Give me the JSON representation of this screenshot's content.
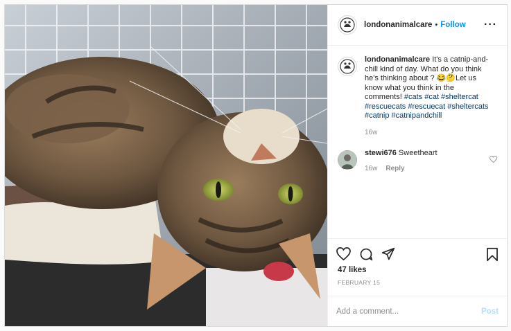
{
  "post": {
    "username": "londonanimalcare",
    "separator": "•",
    "follow_label": "Follow",
    "more_icon": "more-options-icon",
    "caption_user": "londonanimalcare",
    "caption_text": " It's a catnip-and-chill kind of day. What do you think he's thinking about ? 😂🤔Let us know what you think in the comments! ",
    "caption_tags": "#cats #cat #sheltercat #rescuecats #rescuecat #sheltercats #catnip #catnipandchill",
    "caption_age": "16w",
    "comments": [
      {
        "user": "stewi676",
        "text": " Sweetheart",
        "age": "16w",
        "reply_label": "Reply"
      }
    ],
    "likes": "47 likes",
    "date": "FEBRUARY 15",
    "add_comment_placeholder": "Add a comment...",
    "post_label": "Post",
    "icons": [
      "heart-icon",
      "comment-icon",
      "share-icon",
      "bookmark-icon"
    ]
  },
  "colors": {
    "link": "#0095f6",
    "hashtag": "#00376b",
    "muted": "#8e8e8e",
    "post_disabled": "#b2dffc"
  }
}
